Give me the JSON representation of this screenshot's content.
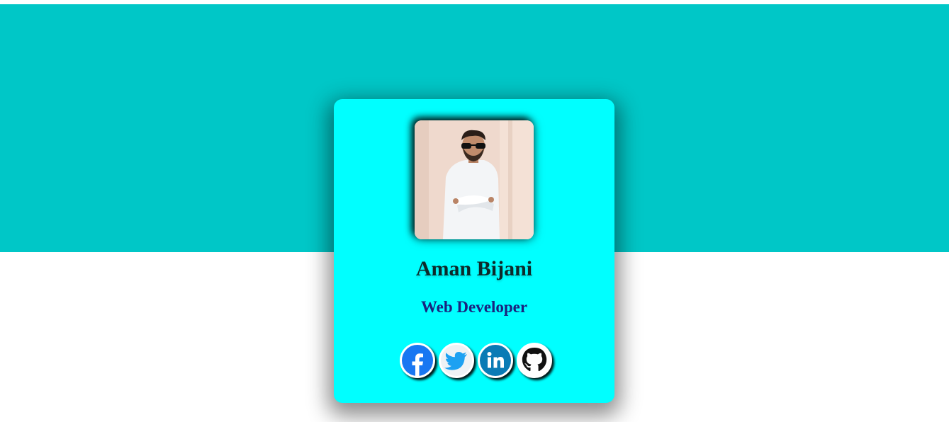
{
  "profile": {
    "name": "Aman Bijani",
    "role": "Web Developer",
    "photo_icon": "profile-photo"
  },
  "socials": [
    {
      "name": "facebook-icon",
      "color": "#1877f2"
    },
    {
      "name": "twitter-icon",
      "color": "#1da1f2"
    },
    {
      "name": "linkedin-icon",
      "color": "#0a7bb5"
    },
    {
      "name": "github-icon",
      "color": "#111111"
    }
  ],
  "colors": {
    "banner": "#00c7c7",
    "card": "#00ffff",
    "name": "#0d2a2a",
    "role": "#1a237e"
  }
}
